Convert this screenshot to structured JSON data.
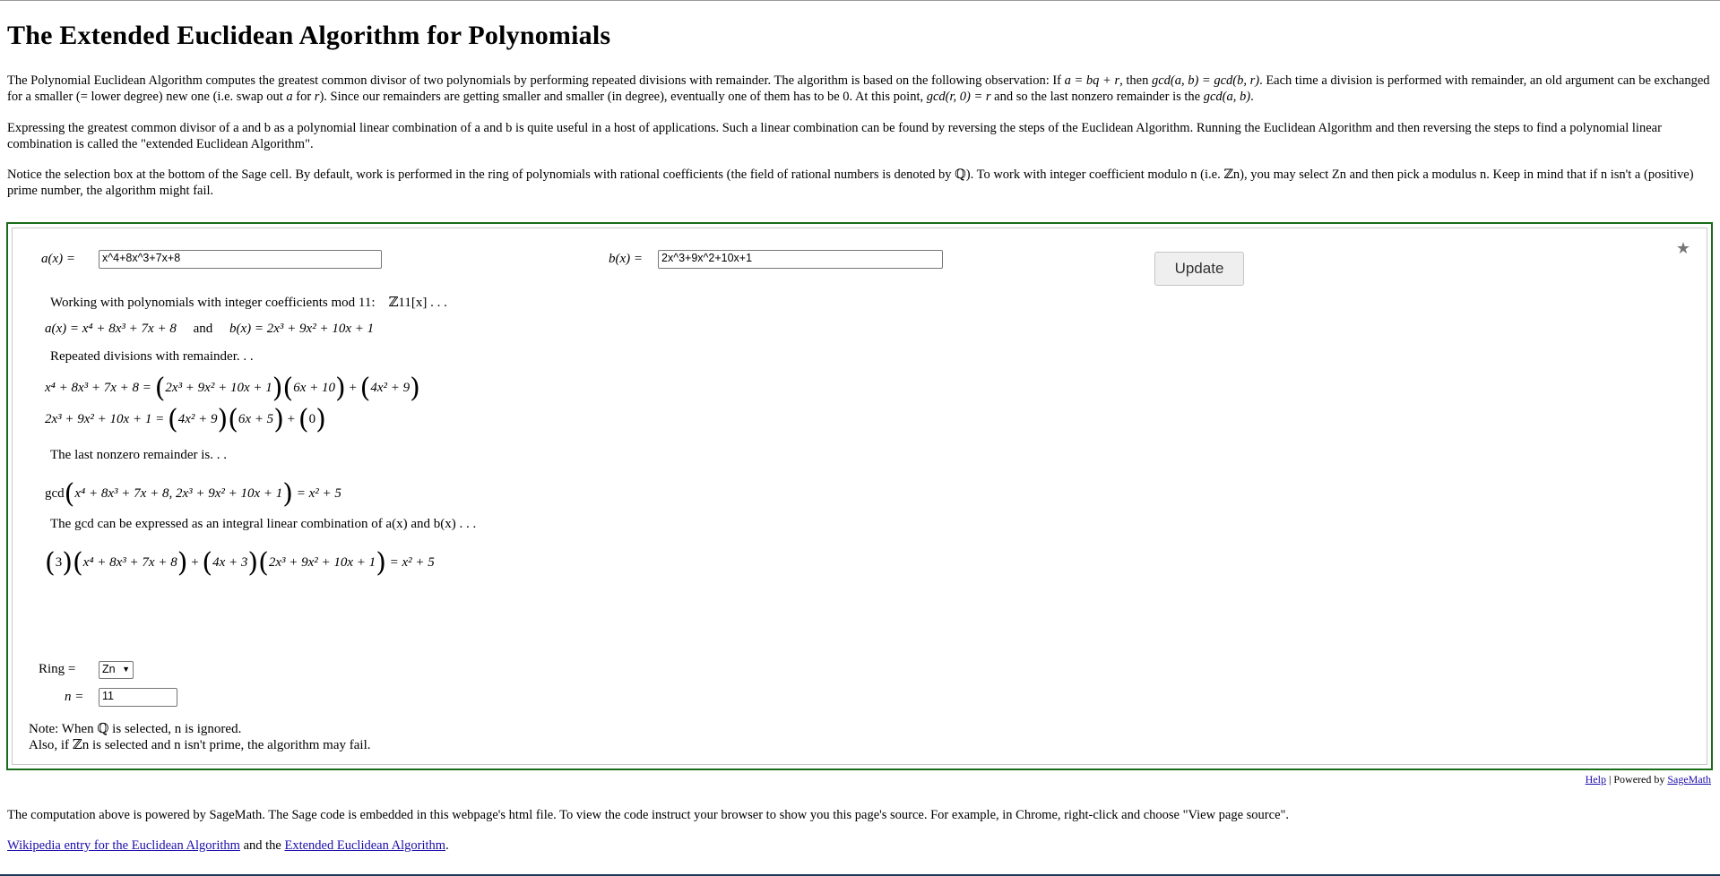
{
  "title": "The Extended Euclidean Algorithm for Polynomials",
  "intro": {
    "p1_a": "The Polynomial Euclidean Algorithm computes the greatest common divisor of two polynomials by performing repeated divisions with remainder. The algorithm is based on the following observation: If ",
    "p1_eq1": "a = bq + r",
    "p1_b": ", then ",
    "p1_eq2": "gcd(a, b) = gcd(b, r)",
    "p1_c": ". Each time a division is performed with remainder, an old argument can be exchanged for a smaller (= lower degree) new one (i.e. swap out ",
    "p1_a_var": "a",
    "p1_d": " for ",
    "p1_r_var": "r",
    "p1_e": "). Since our remainders are getting smaller and smaller (in degree), eventually one of them has to be ",
    "p1_zero": "0",
    "p1_f": ". At this point, ",
    "p1_eq3": "gcd(r, 0) = r",
    "p1_g": " and so the last nonzero remainder is the ",
    "p1_eq4": "gcd(a, b)",
    "p1_h": ".",
    "p2": "Expressing the greatest common divisor of a and b as a polynomial linear combination of a and b is quite useful in a host of applications. Such a linear combination can be found by reversing the steps of the Euclidean Algorithm. Running the Euclidean Algorithm and then reversing the steps to find a polynomial linear combination is called the \"extended Euclidean Algorithm\".",
    "p3": "Notice the selection box at the bottom of the Sage cell. By default, work is performed in the ring of polynomials with rational coefficients (the field of rational numbers is denoted by ℚ). To work with integer coefficient modulo n (i.e. ℤn), you may select Zn and then pick a modulus n. Keep in mind that if n isn't a (positive) prime number, the algorithm might fail."
  },
  "cell": {
    "star": "★",
    "a_label": "a(x) =",
    "a_value": "x^4+8x^3+7x+8",
    "b_label": "b(x) =",
    "b_value": "2x^3+9x^2+10x+1",
    "update": "Update",
    "working": "Working with polynomials with integer coefficients mod 11:",
    "working_ring": "ℤ11[x] . . .",
    "ab_line_a": "a(x) = x⁴ + 8x³ + 7x + 8",
    "ab_and": "and",
    "ab_line_b": "b(x) = 2x³ + 9x² + 10x + 1",
    "repeated": "Repeated divisions with remainder. . .",
    "div1_lhs": "x⁴ + 8x³ + 7x + 8 =",
    "div1_a": "2x³ + 9x² + 10x + 1",
    "div1_b": "6x + 10",
    "div1_c": "4x² + 9",
    "div2_lhs": "2x³ + 9x² + 10x + 1 =",
    "div2_a": "4x² + 9",
    "div2_b": "6x + 5",
    "div2_c": "0",
    "last_nonzero": "The last nonzero remainder is. . .",
    "gcd_word": "gcd",
    "gcd_args": "x⁴ + 8x³ + 7x + 8,    2x³ + 9x² + 10x + 1",
    "gcd_result": "= x² + 5",
    "lincomb_text": "The gcd can be expressed as an integral linear combination of a(x) and b(x) . . .",
    "lc_c1": "3",
    "lc_a": "x⁴ + 8x³ + 7x + 8",
    "lc_c2": "4x + 3",
    "lc_b": "2x³ + 9x² + 10x + 1",
    "lc_result": "= x² + 5",
    "ring_label": "Ring =",
    "ring_value": "Zn",
    "n_label": "n =",
    "n_value": "11",
    "note1": "Note: When ℚ is selected, n is ignored.",
    "note2": "Also, if ℤn is selected and n isn't prime, the algorithm may fail."
  },
  "footer": {
    "help": "Help",
    "powered": " | Powered by ",
    "sagemath": "SageMath",
    "p_compute": "The computation above is powered by SageMath. The Sage code is embedded in this webpage's html file. To view the code instruct your browser to show you this page's source. For example, in Chrome, right-click and choose \"View page source\".",
    "wiki_link": "Wikipedia entry for the Euclidean Algorithm",
    "and_the": " and the ",
    "ext_link": "Extended Euclidean Algorithm",
    "period": "."
  }
}
